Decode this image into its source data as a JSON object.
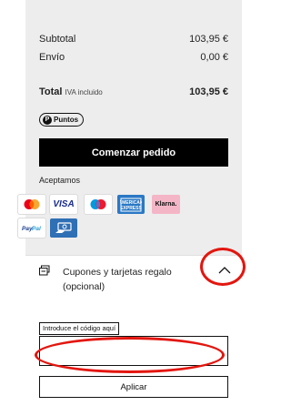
{
  "summary": {
    "subtotal_label": "Subtotal",
    "subtotal_value": "103,95 €",
    "shipping_label": "Envío",
    "shipping_value": "0,00 €",
    "total_label": "Total",
    "total_note": "IVA incluido",
    "total_value": "103,95 €"
  },
  "points_badge": {
    "icon_letter": "P",
    "label": "Puntos"
  },
  "checkout_button": "Comenzar pedido",
  "payment": {
    "label": "Aceptamos",
    "methods": [
      {
        "name": "Mastercard",
        "icon": "mastercard-logo"
      },
      {
        "name": "VISA",
        "icon": "visa-logo"
      },
      {
        "name": "Maestro",
        "icon": "maestro-logo"
      },
      {
        "name": "American Express",
        "icon": "amex-logo"
      },
      {
        "name": "Klarna.",
        "icon": "klarna-logo"
      },
      {
        "name": "PayPal",
        "icon": "paypal-logo"
      },
      {
        "name": "Pago en efectivo",
        "icon": "cash-icon"
      }
    ]
  },
  "coupons": {
    "label": "Cupones y tarjetas regalo (opcional)",
    "icon": "gift-card-icon",
    "toggle_icon": "chevron-up-icon",
    "input_label": "Introduce el código aquí",
    "input_value": "",
    "apply_button": "Aplicar"
  },
  "colors": {
    "summary_bg": "#ededed",
    "button_bg": "#000000",
    "annotation": "#e3160f"
  }
}
